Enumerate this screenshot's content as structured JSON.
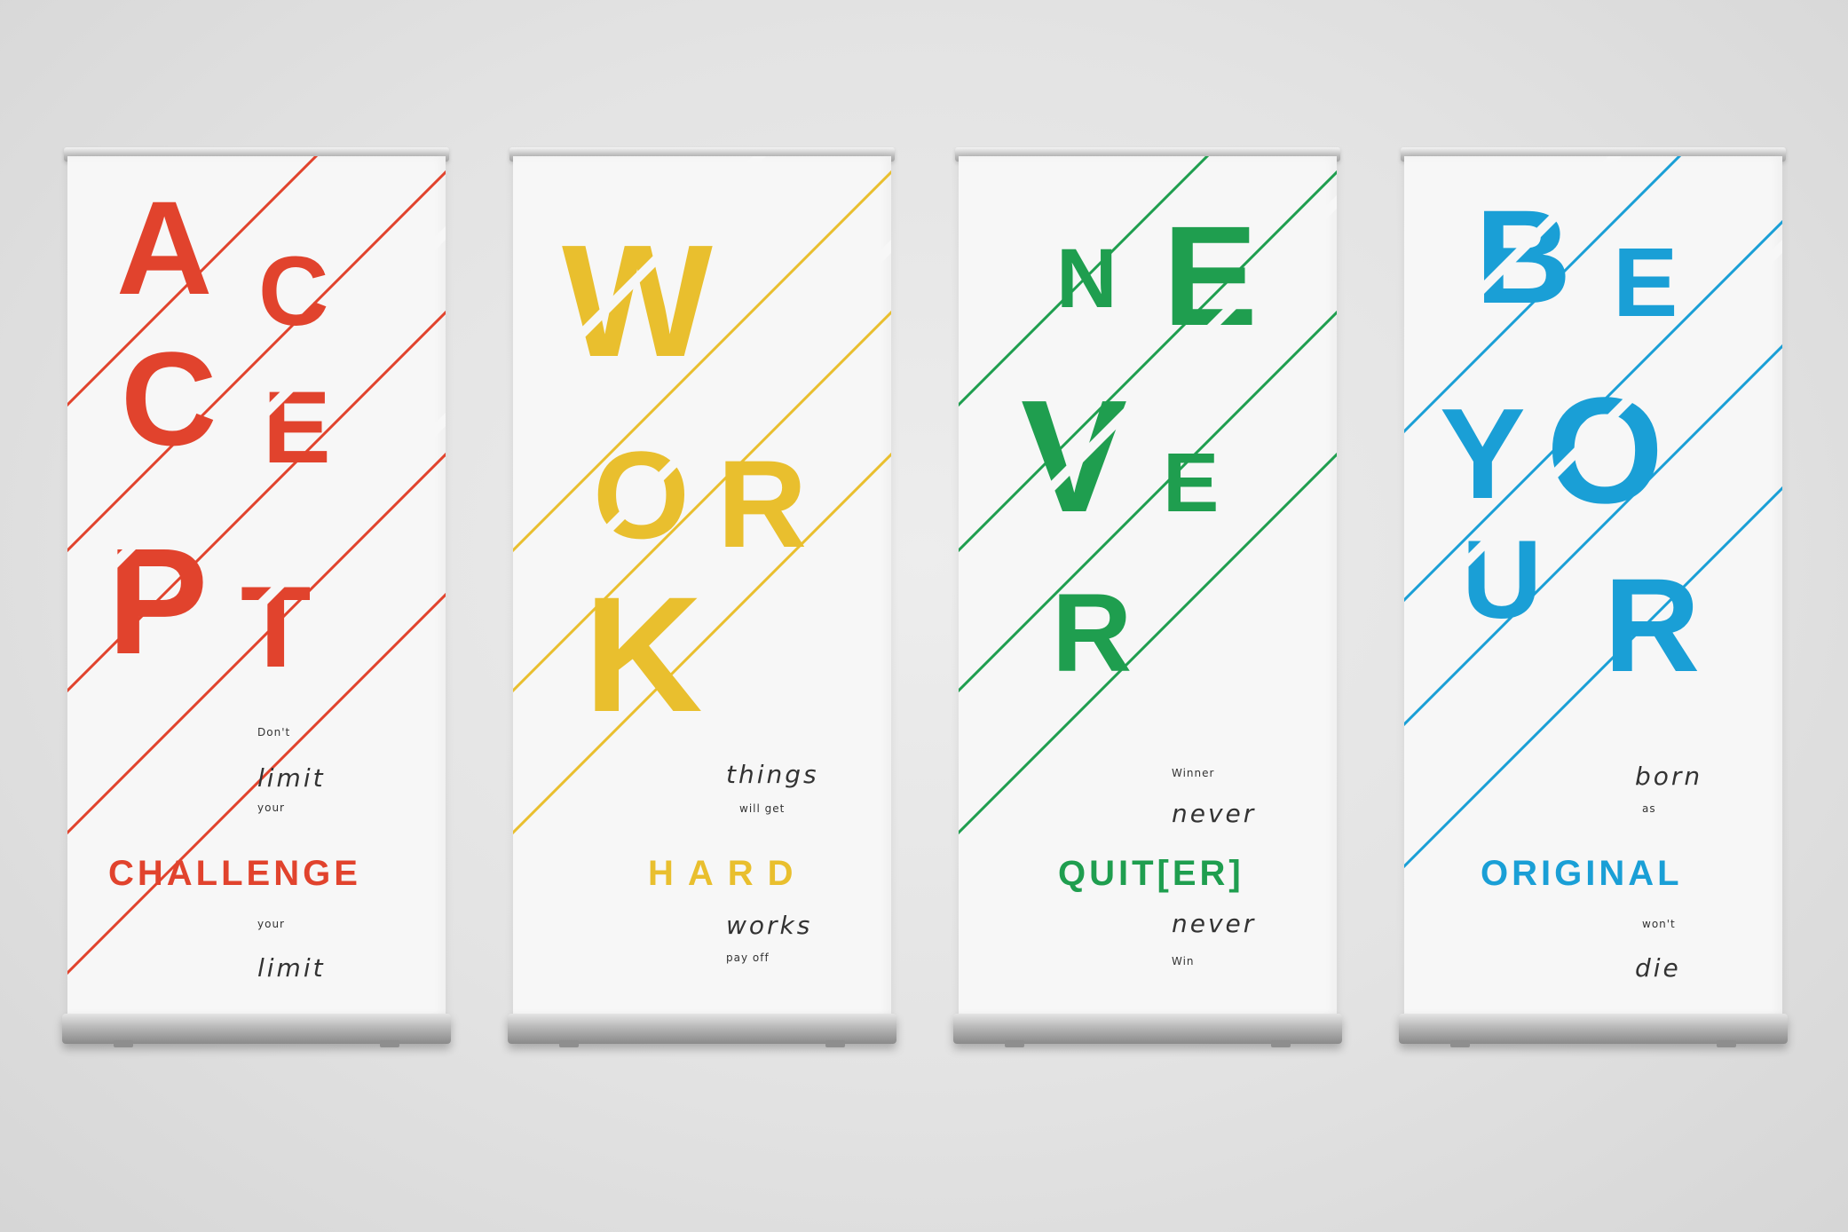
{
  "banners": [
    {
      "color": "#e1432d",
      "letters": [
        "A",
        "C",
        "C",
        "E",
        "P",
        "T"
      ],
      "lines": [
        "Don't",
        "limit",
        "your",
        "CHALLENGE",
        "your",
        "limit"
      ]
    },
    {
      "color": "#e9bf2e",
      "letters": [
        "W",
        "O",
        "R",
        "K"
      ],
      "lines": [
        "things",
        "will get",
        "HARD",
        "works",
        "pay off"
      ]
    },
    {
      "color": "#1f9e4f",
      "letters": [
        "N",
        "E",
        "V",
        "E",
        "R"
      ],
      "lines": [
        "Winner",
        "never",
        "QUIT[ER]",
        "never",
        "Win"
      ]
    },
    {
      "color": "#1a9fd6",
      "letters": [
        "B",
        "E",
        "Y",
        "O",
        "U",
        "R"
      ],
      "lines": [
        "born",
        "as",
        "ORIGINAL",
        "won't",
        "die"
      ]
    }
  ]
}
